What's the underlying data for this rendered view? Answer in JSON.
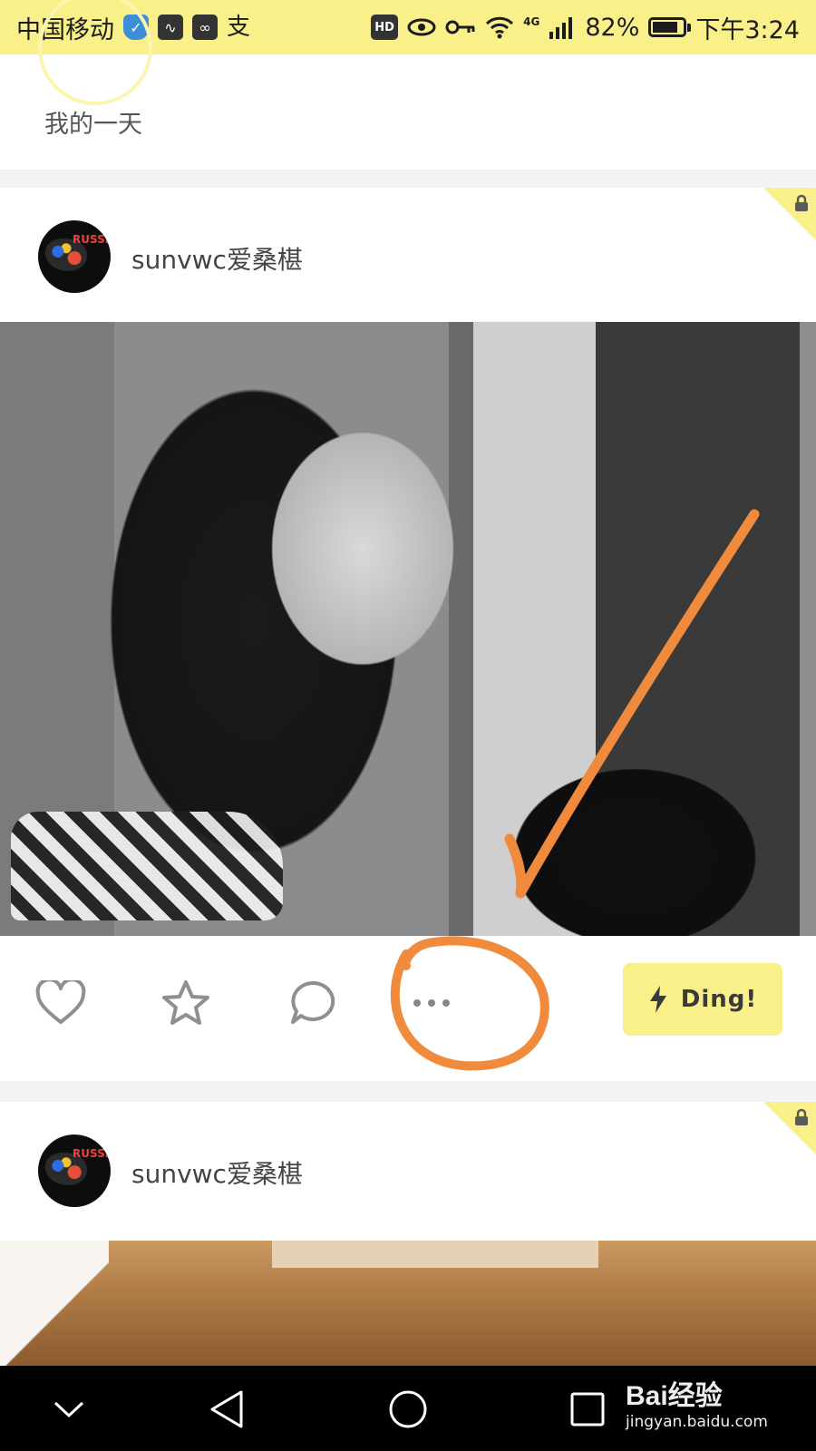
{
  "status_bar": {
    "carrier": "中国移动",
    "network": "4G",
    "battery": "82%",
    "battery_level": 0.82,
    "time": "下午3:24",
    "hd_badge": "HD",
    "icons": [
      "shield-icon",
      "activity-icon",
      "link-icon",
      "alipay-icon",
      "hd-icon",
      "eye-icon",
      "key-icon",
      "wifi-icon",
      "signal-icon",
      "battery-icon"
    ]
  },
  "feed": {
    "diary_title": "我的一天",
    "posts": [
      {
        "username": "sunvwc爱桑椹",
        "avatar_text": "RUSSIA",
        "locked": true
      },
      {
        "username": "sunvwc爱桑椹",
        "avatar_text": "RUSSIA",
        "locked": true
      }
    ]
  },
  "actions": {
    "like": "heart-icon",
    "favorite": "star-icon",
    "comment": "comment-icon",
    "more": "more-icon",
    "ding_label": "Ding!"
  },
  "nav": {
    "buttons": [
      "hide-keyboard-icon",
      "back-icon",
      "home-icon",
      "recents-icon"
    ]
  },
  "watermark": {
    "brand": "Bai经验",
    "url": "jingyan.baidu.com"
  },
  "colors": {
    "accent_yellow": "#faf08a",
    "annotation_orange": "#f08a3c"
  }
}
